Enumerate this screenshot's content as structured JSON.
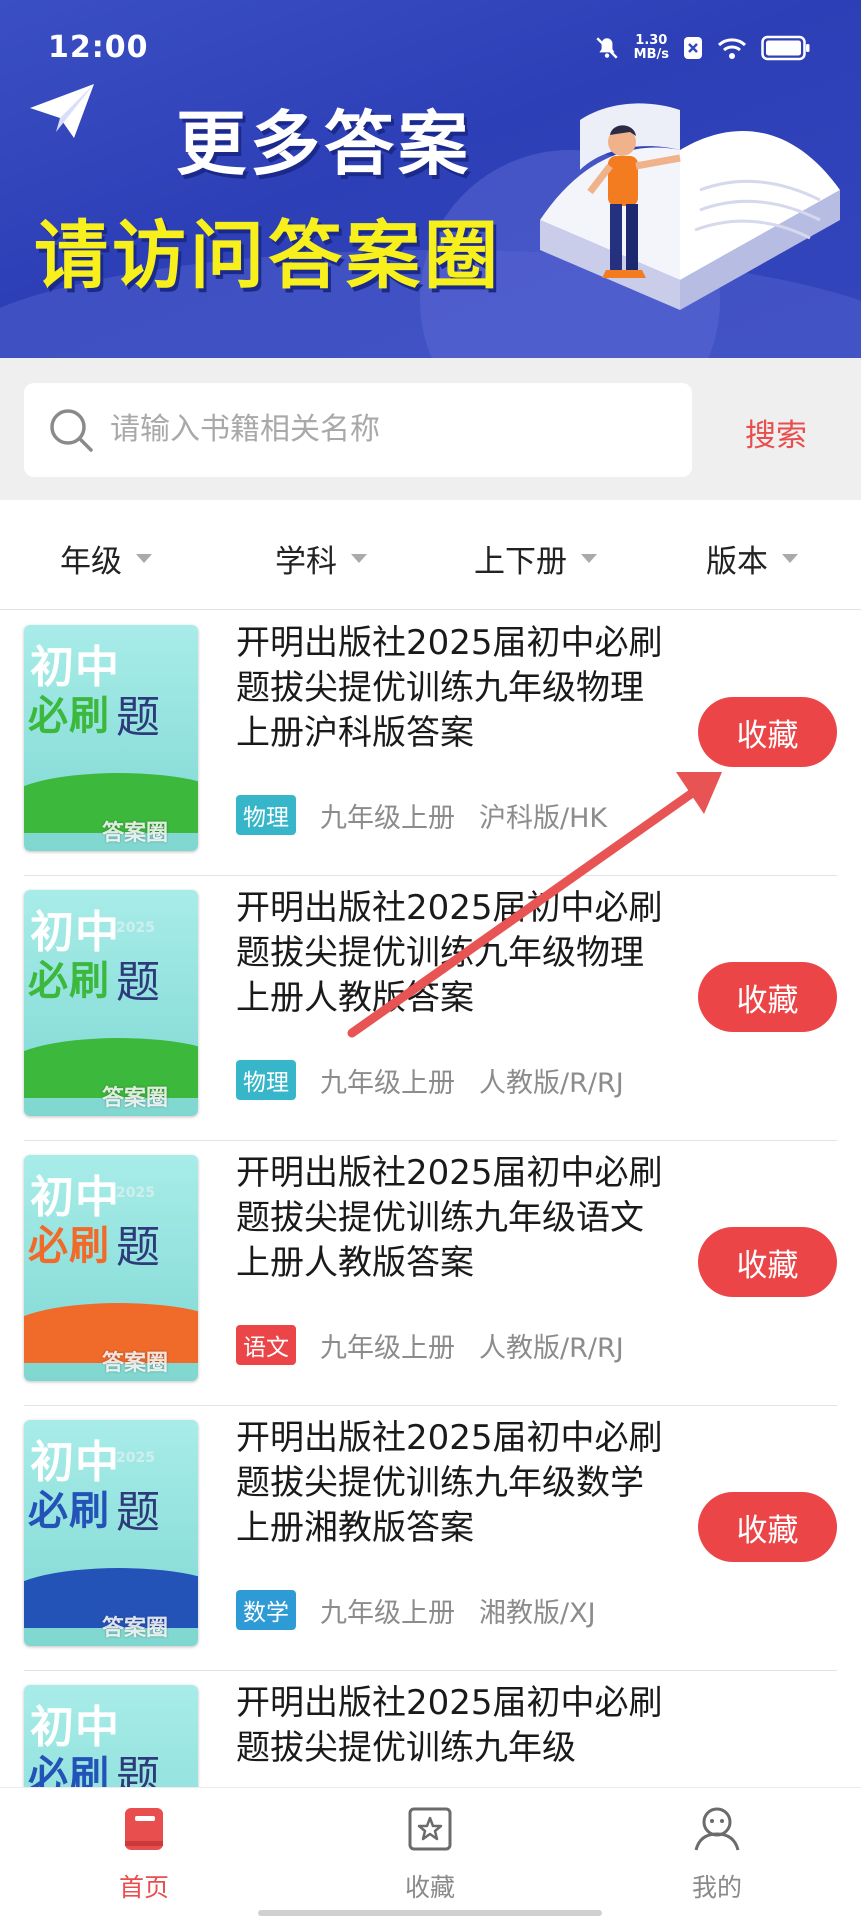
{
  "status_bar": {
    "time": "12:00",
    "network_speed": "1.30",
    "network_unit": "MB/s"
  },
  "banner": {
    "line1": "更多答案",
    "line2": "请访问答案圈"
  },
  "search": {
    "placeholder": "请输入书籍相关名称",
    "value": "",
    "button_label": "搜索"
  },
  "filters": [
    {
      "label": "年级"
    },
    {
      "label": "学科"
    },
    {
      "label": "上下册"
    },
    {
      "label": "版本"
    }
  ],
  "favorite_label": "收藏",
  "books": [
    {
      "title": "开明出版社2025届初中必刷题拔尖提优训练九年级物理上册沪科版答案",
      "subject": "物理",
      "subject_color": "#38b6c9",
      "grade": "九年级上册",
      "edition": "沪科版/HK",
      "cover_text1": "初中",
      "cover_text2": "必刷",
      "cover_text3": "题",
      "cover_year": "",
      "cover_accent": "#3cb83c"
    },
    {
      "title": "开明出版社2025届初中必刷题拔尖提优训练九年级物理上册人教版答案",
      "subject": "物理",
      "subject_color": "#38b6c9",
      "grade": "九年级上册",
      "edition": "人教版/R/RJ",
      "cover_text1": "初中",
      "cover_text2": "必刷",
      "cover_text3": "题",
      "cover_year": "2025",
      "cover_accent": "#3cb83c"
    },
    {
      "title": "开明出版社2025届初中必刷题拔尖提优训练九年级语文上册人教版答案",
      "subject": "语文",
      "subject_color": "#ec4548",
      "grade": "九年级上册",
      "edition": "人教版/R/RJ",
      "cover_text1": "初中",
      "cover_text2": "必刷",
      "cover_text3": "题",
      "cover_year": "2025",
      "cover_accent": "#f06a2a"
    },
    {
      "title": "开明出版社2025届初中必刷题拔尖提优训练九年级数学上册湘教版答案",
      "subject": "数学",
      "subject_color": "#2f9bd6",
      "grade": "九年级上册",
      "edition": "湘教版/XJ",
      "cover_text1": "初中",
      "cover_text2": "必刷",
      "cover_text3": "题",
      "cover_year": "2025",
      "cover_accent": "#2453b8"
    },
    {
      "title": "开明出版社2025届初中必刷题拔尖提优训练九年级",
      "subject": "",
      "subject_color": "#2f9bd6",
      "grade": "",
      "edition": "",
      "cover_text1": "初中",
      "cover_text2": "必刷",
      "cover_text3": "题",
      "cover_year": "",
      "cover_accent": "#2453b8"
    }
  ],
  "cover_stamp": "答案圈",
  "bottom_nav": [
    {
      "label": "首页",
      "icon": "book-icon",
      "active": true
    },
    {
      "label": "收藏",
      "icon": "star-icon",
      "active": false
    },
    {
      "label": "我的",
      "icon": "user-icon",
      "active": false
    }
  ],
  "colors": {
    "accent": "#ec4548",
    "banner": "#3446bd",
    "headline_yellow": "#f7f01c"
  }
}
